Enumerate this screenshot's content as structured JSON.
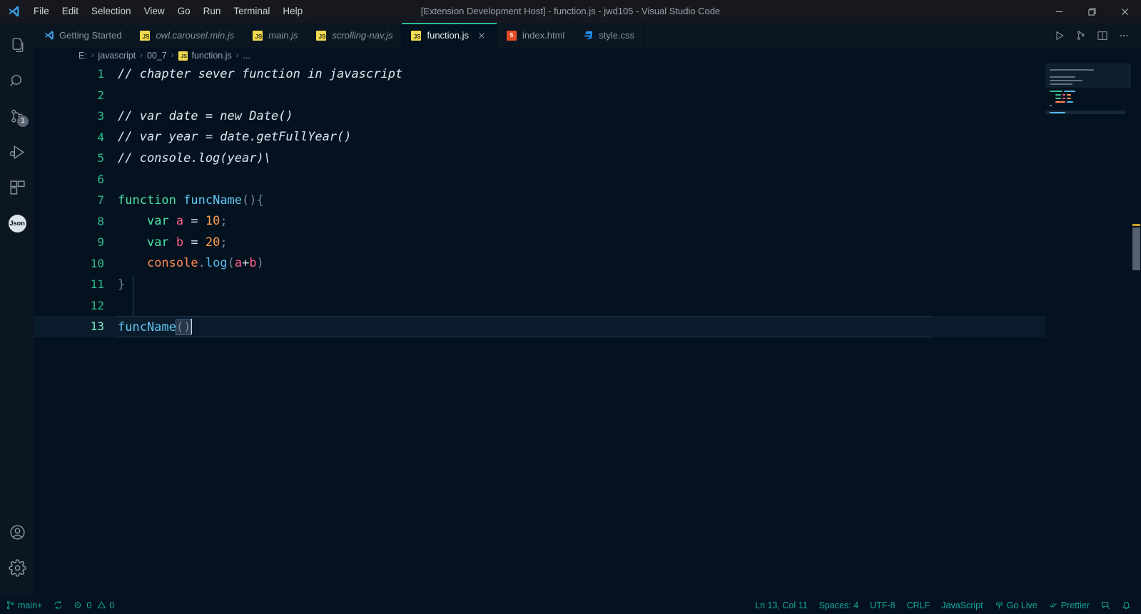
{
  "window": {
    "title": "[Extension Development Host] - function.js - jwd105 - Visual Studio Code",
    "minimize_label": "Minimize",
    "maximize_label": "Restore",
    "close_label": "Close"
  },
  "menu": {
    "items": [
      {
        "label": "File"
      },
      {
        "label": "Edit"
      },
      {
        "label": "Selection"
      },
      {
        "label": "View"
      },
      {
        "label": "Go"
      },
      {
        "label": "Run"
      },
      {
        "label": "Terminal"
      },
      {
        "label": "Help"
      }
    ]
  },
  "activitybar": {
    "items": [
      {
        "name": "explorer",
        "icon": "files-icon",
        "badge": ""
      },
      {
        "name": "search",
        "icon": "search-icon",
        "badge": ""
      },
      {
        "name": "source-control",
        "icon": "source-control-icon",
        "badge": "1"
      },
      {
        "name": "run-and-debug",
        "icon": "run-debug-icon",
        "badge": ""
      },
      {
        "name": "extensions",
        "icon": "extensions-icon",
        "badge": ""
      },
      {
        "name": "json-viewer",
        "icon": "json-icon",
        "badge": "",
        "chip_label": "Json"
      }
    ],
    "bottom": [
      {
        "name": "account",
        "icon": "account-icon"
      },
      {
        "name": "manage-settings",
        "icon": "gear-icon"
      }
    ]
  },
  "tabs": [
    {
      "label": "Getting Started",
      "icon": "vscode-icon",
      "active": false,
      "italic": false,
      "closable": false
    },
    {
      "label": "owl.carousel.min.js",
      "icon": "js-icon",
      "active": false,
      "italic": true,
      "closable": false
    },
    {
      "label": "main.js",
      "icon": "js-icon",
      "active": false,
      "italic": true,
      "closable": false
    },
    {
      "label": "scrolling-nav.js",
      "icon": "js-icon",
      "active": false,
      "italic": true,
      "closable": false
    },
    {
      "label": "function.js",
      "icon": "js-icon",
      "active": true,
      "italic": false,
      "closable": true
    },
    {
      "label": "index.html",
      "icon": "html-icon",
      "active": false,
      "italic": false,
      "closable": false
    },
    {
      "label": "style.css",
      "icon": "css-icon",
      "active": false,
      "italic": false,
      "closable": false
    }
  ],
  "editor_actions": [
    {
      "name": "run-code-button",
      "icon": "play-icon"
    },
    {
      "name": "split-terminal-button",
      "icon": "source-control-icon"
    },
    {
      "name": "split-editor-button",
      "icon": "split-editor-icon"
    },
    {
      "name": "more-actions-button",
      "icon": "ellipsis-icon"
    }
  ],
  "breadcrumb": {
    "items": [
      {
        "label": "E:",
        "icon": ""
      },
      {
        "label": "javascript",
        "icon": ""
      },
      {
        "label": "00_7",
        "icon": ""
      },
      {
        "label": "function.js",
        "icon": "js-icon"
      },
      {
        "label": "...",
        "icon": ""
      }
    ],
    "separator": "›"
  },
  "editor": {
    "filename": "function.js",
    "language": "JavaScript",
    "current_line": 13,
    "lines": [
      {
        "n": "1",
        "text": "// chapter sever function in javascript"
      },
      {
        "n": "2",
        "text": ""
      },
      {
        "n": "3",
        "text": "// var date = new Date()"
      },
      {
        "n": "4",
        "text": "// var year = date.getFullYear()"
      },
      {
        "n": "5",
        "text": "// console.log(year)\\"
      },
      {
        "n": "6",
        "text": ""
      },
      {
        "n": "7",
        "text": "function funcName(){"
      },
      {
        "n": "8",
        "text": "    var a = 10;"
      },
      {
        "n": "9",
        "text": "    var b = 20;"
      },
      {
        "n": "10",
        "text": "    console.log(a+b)"
      },
      {
        "n": "11",
        "text": "}"
      },
      {
        "n": "12",
        "text": ""
      },
      {
        "n": "13",
        "text": "funcName()"
      }
    ],
    "tokens": {
      "l1": {
        "comment": "// chapter sever function in javascript"
      },
      "l3": {
        "comment": "// var date = new Date()"
      },
      "l4": {
        "comment": "// var year = date.getFullYear()"
      },
      "l5": {
        "comment": "// console.log(year)\\"
      },
      "l7": {
        "kw": "function",
        "fn": "funcName",
        "paren": "()",
        "brace": "{"
      },
      "l8": {
        "kw": "var",
        "var": "a",
        "op": "=",
        "num": "10",
        "semi": ";"
      },
      "l9": {
        "kw": "var",
        "var": "b",
        "op": "=",
        "num": "20",
        "semi": ";"
      },
      "l10": {
        "obj": "console",
        "dot": ".",
        "meth": "log",
        "p1": "(",
        "va": "a",
        "plus": "+",
        "vb": "b",
        "p2": ")"
      },
      "l11": {
        "brace": "}"
      },
      "l13": {
        "fn": "funcName",
        "paren": "()"
      }
    }
  },
  "statusbar": {
    "left": [
      {
        "name": "branch",
        "icon": "branch-icon",
        "label": "main+"
      },
      {
        "name": "sync",
        "icon": "sync-icon",
        "label": ""
      },
      {
        "name": "problems",
        "icon": "error-warning-icon",
        "label": "0  0",
        "errors": "0",
        "warnings": "0"
      }
    ],
    "right": [
      {
        "name": "cursor-position",
        "icon": "",
        "label": "Ln 13, Col 11"
      },
      {
        "name": "indentation",
        "icon": "",
        "label": "Spaces: 4"
      },
      {
        "name": "encoding",
        "icon": "",
        "label": "UTF-8"
      },
      {
        "name": "eol",
        "icon": "",
        "label": "CRLF"
      },
      {
        "name": "language-mode",
        "icon": "",
        "label": "JavaScript"
      },
      {
        "name": "go-live",
        "icon": "broadcast-icon",
        "label": "Go Live"
      },
      {
        "name": "prettier",
        "icon": "check-check-icon",
        "label": "Prettier"
      },
      {
        "name": "remote-feedback",
        "icon": "feedback-icon",
        "label": ""
      },
      {
        "name": "notifications",
        "icon": "bell-icon",
        "label": ""
      }
    ]
  },
  "colors": {
    "titlebar_bg": "#16181d",
    "activitybar_bg": "#0b1622",
    "tabsbar_bg": "#0b1622",
    "editor_bg": "#04121f",
    "statusbar_fg": "#15a79a",
    "active_tab_border": "#2bbc9b",
    "linenumber": "#2dbd8c",
    "comment": "#dce6f0",
    "keyword": "#4ee6a6",
    "function": "#62c7f2",
    "variable": "#ff5c8a",
    "number": "#ff9e4f",
    "object": "#ff8a50",
    "method": "#58b9ea"
  }
}
